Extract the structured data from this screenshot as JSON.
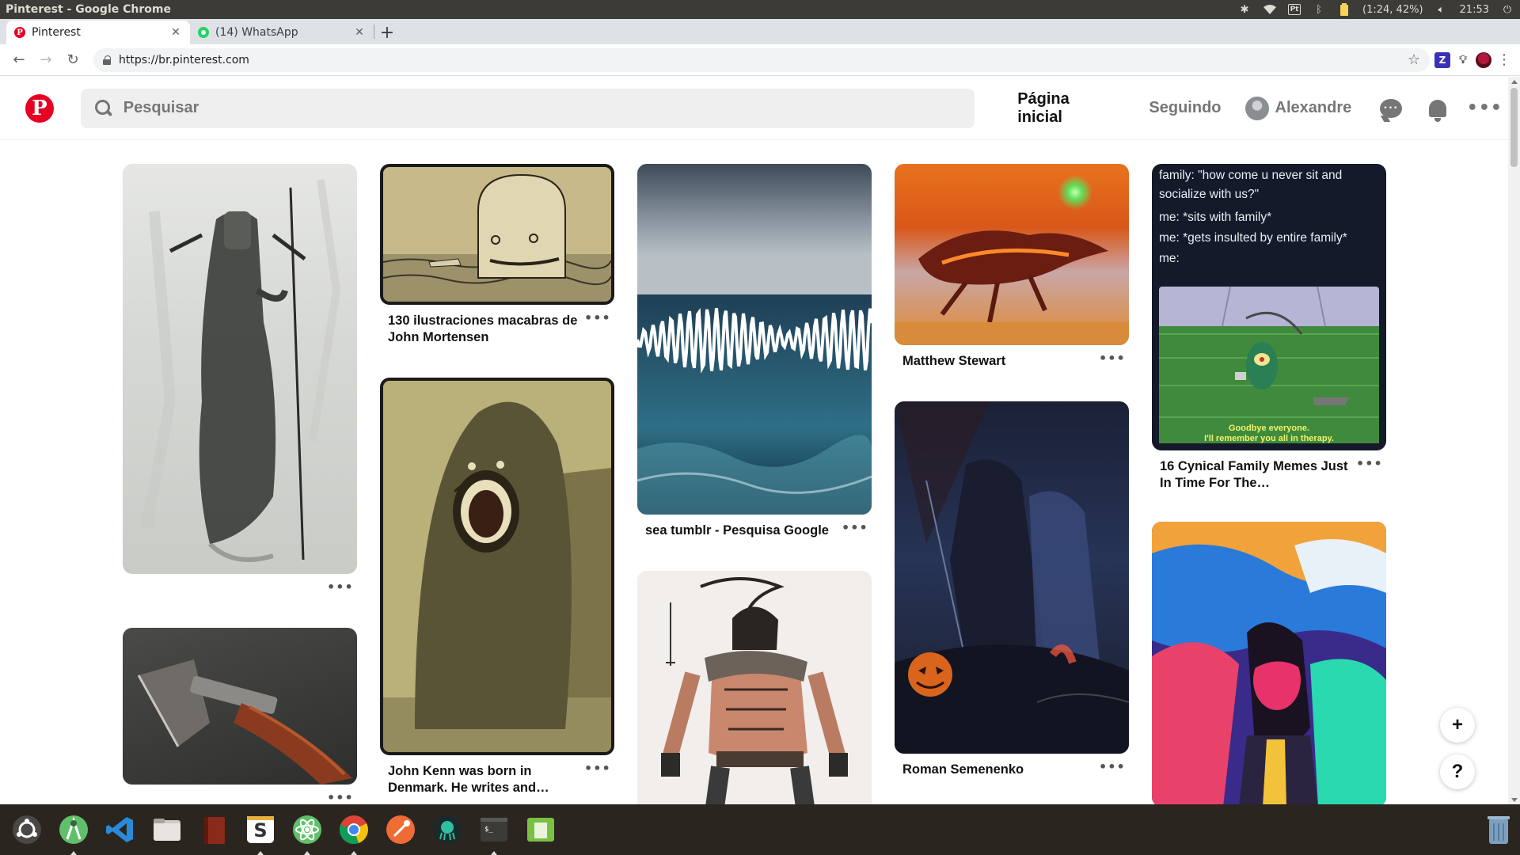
{
  "os": {
    "window_title": "Pinterest - Google Chrome",
    "battery_text": "(1:24, 42%)",
    "keyboard_layout": "Pt",
    "clock": "21:53"
  },
  "browser": {
    "tabs": [
      {
        "label": "Pinterest",
        "active": true,
        "favicon": "pinterest-icon"
      },
      {
        "label": "(14) WhatsApp",
        "active": false,
        "favicon": "whatsapp-icon"
      }
    ],
    "url": "https://br.pinterest.com"
  },
  "pinterest": {
    "search_placeholder": "Pesquisar",
    "nav": {
      "home": "Página inicial",
      "following": "Seguindo",
      "user": "Alexandre"
    }
  },
  "pins": [
    {
      "id": "spirit",
      "title": ""
    },
    {
      "id": "axe",
      "title": ""
    },
    {
      "id": "monster-whale",
      "title": "130 ilustraciones macabras de John Mortensen"
    },
    {
      "id": "monster-cliff",
      "title": "John Kenn was born in Denmark. He writes and…"
    },
    {
      "id": "sea",
      "title": "sea tumblr - Pesquisa Google"
    },
    {
      "id": "warrior",
      "title": ""
    },
    {
      "id": "dragon",
      "title": "Matthew Stewart"
    },
    {
      "id": "reaper",
      "title": "Roman Semenenko"
    },
    {
      "id": "meme",
      "title": "16 Cynical Family Memes Just In Time For The…"
    },
    {
      "id": "colorful",
      "title": ""
    }
  ],
  "meme_text": {
    "line1": "family: \"how come u never sit and socialize with us?\"",
    "line2": "me: *sits with family*",
    "line3": "me: *gets insulted by entire family*",
    "line4": "me:",
    "caption1": "Goodbye everyone.",
    "caption2": "I'll remember you all in therapy."
  },
  "fabs": {
    "add": "+",
    "help": "?"
  },
  "dock_items": [
    "ubuntu-icon",
    "android-studio-icon",
    "vscode-icon",
    "files-icon",
    "book-icon",
    "slack-icon",
    "atom-icon",
    "chrome-icon",
    "postman-icon",
    "gitkraken-icon",
    "terminal-icon",
    "system-monitor-icon"
  ]
}
